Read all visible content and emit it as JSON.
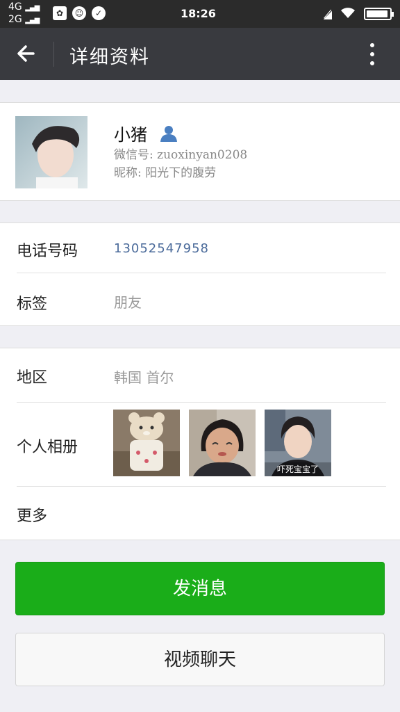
{
  "status_bar": {
    "network_top": "4G",
    "network_bottom": "2G",
    "time": "18:26",
    "battery_level": 0.95
  },
  "title_bar": {
    "title": "详细资料"
  },
  "profile": {
    "name": "小猪",
    "wechat_id": "微信号: zuoxinyan0208",
    "nickname": "昵称: 阳光下的腹劳"
  },
  "contact": {
    "phone_label": "电话号码",
    "phone_value": "13052547958",
    "tag_label": "标签",
    "tag_value": "朋友"
  },
  "details": {
    "region_label": "地区",
    "region_value": "韩国  首尔",
    "album_label": "个人相册",
    "album_caption_3": "吓死宝宝了",
    "more_label": "更多"
  },
  "actions": {
    "send_message": "发消息",
    "video_call": "视频聊天"
  },
  "colors": {
    "title_bar": "#393a3f",
    "status_bar": "#2b2b2b",
    "primary_button": "#1aad19",
    "background": "#efeff4"
  }
}
